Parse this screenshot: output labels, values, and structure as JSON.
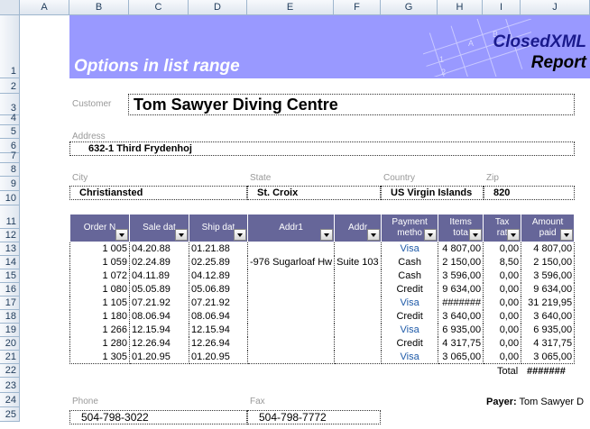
{
  "columns": [
    "A",
    "B",
    "C",
    "D",
    "E",
    "F",
    "G",
    "H",
    "I",
    "J"
  ],
  "rows": [
    "1",
    "2",
    "3",
    "4",
    "5",
    "6",
    "7",
    "8",
    "9",
    "10",
    "11",
    "12",
    "13",
    "14",
    "15",
    "16",
    "17",
    "18",
    "19",
    "20",
    "21",
    "22",
    "23",
    "24",
    "25"
  ],
  "banner": {
    "title": "Options in list range",
    "logo_line1": "ClosedXML",
    "logo_line2": "Report",
    "deco_a": "A",
    "deco_b": "B",
    "deco_1": "1",
    "deco_2": "2"
  },
  "customer": {
    "label": "Customer",
    "value": "Tom Sawyer Diving Centre"
  },
  "address": {
    "label": "Address",
    "value": "632-1 Third Frydenhoj"
  },
  "city": {
    "label": "City",
    "value": "Christiansted"
  },
  "state": {
    "label": "State",
    "value": "St. Croix"
  },
  "country": {
    "label": "Country",
    "value": "US Virgin Islands"
  },
  "zip": {
    "label": "Zip",
    "value": "820"
  },
  "table": {
    "headers": [
      {
        "l1": "Order N",
        "l2": ""
      },
      {
        "l1": "Sale dat",
        "l2": ""
      },
      {
        "l1": "Ship dat",
        "l2": ""
      },
      {
        "l1": "Addr1",
        "l2": ""
      },
      {
        "l1": "Addr",
        "l2": ""
      },
      {
        "l1": "Payment",
        "l2": "metho"
      },
      {
        "l1": "Items",
        "l2": "tota"
      },
      {
        "l1": "Tax",
        "l2": "rat"
      },
      {
        "l1": "Amount",
        "l2": "paid"
      }
    ],
    "rows": [
      {
        "order": "1 005",
        "sale": "04.20.88",
        "ship": "01.21.88",
        "addr1": "",
        "addr2": "",
        "pay": "Visa",
        "items": "4 807,00",
        "tax": "0,00",
        "amount": "4 807,00"
      },
      {
        "order": "1 059",
        "sale": "02.24.89",
        "ship": "02.25.89",
        "addr1": "-976 Sugarloaf Hw",
        "addr2": "Suite 103",
        "pay": "Cash",
        "items": "2 150,00",
        "tax": "8,50",
        "amount": "2 150,00"
      },
      {
        "order": "1 072",
        "sale": "04.11.89",
        "ship": "04.12.89",
        "addr1": "",
        "addr2": "",
        "pay": "Cash",
        "items": "3 596,00",
        "tax": "0,00",
        "amount": "3 596,00"
      },
      {
        "order": "1 080",
        "sale": "05.05.89",
        "ship": "05.06.89",
        "addr1": "",
        "addr2": "",
        "pay": "Credit",
        "items": "9 634,00",
        "tax": "0,00",
        "amount": "9 634,00"
      },
      {
        "order": "1 105",
        "sale": "07.21.92",
        "ship": "07.21.92",
        "addr1": "",
        "addr2": "",
        "pay": "Visa",
        "items": "#######",
        "tax": "0,00",
        "amount": "31 219,95"
      },
      {
        "order": "1 180",
        "sale": "08.06.94",
        "ship": "08.06.94",
        "addr1": "",
        "addr2": "",
        "pay": "Credit",
        "items": "3 640,00",
        "tax": "0,00",
        "amount": "3 640,00"
      },
      {
        "order": "1 266",
        "sale": "12.15.94",
        "ship": "12.15.94",
        "addr1": "",
        "addr2": "",
        "pay": "Visa",
        "items": "6 935,00",
        "tax": "0,00",
        "amount": "6 935,00"
      },
      {
        "order": "1 280",
        "sale": "12.26.94",
        "ship": "12.26.94",
        "addr1": "",
        "addr2": "",
        "pay": "Credit",
        "items": "4 317,75",
        "tax": "0,00",
        "amount": "4 317,75"
      },
      {
        "order": "1 305",
        "sale": "01.20.95",
        "ship": "01.20.95",
        "addr1": "",
        "addr2": "",
        "pay": "Visa",
        "items": "3 065,00",
        "tax": "0,00",
        "amount": "3 065,00"
      }
    ]
  },
  "total": {
    "label": "Total",
    "value": "#######"
  },
  "phone": {
    "label": "Phone",
    "value": "504-798-3022"
  },
  "fax": {
    "label": "Fax",
    "value": "504-798-7772"
  },
  "payer": {
    "label": "Payer:",
    "value": "Tom Sawyer D"
  },
  "colors": {
    "banner": "#9999ff",
    "header": "#666699",
    "visa": "#1e5aa8"
  }
}
